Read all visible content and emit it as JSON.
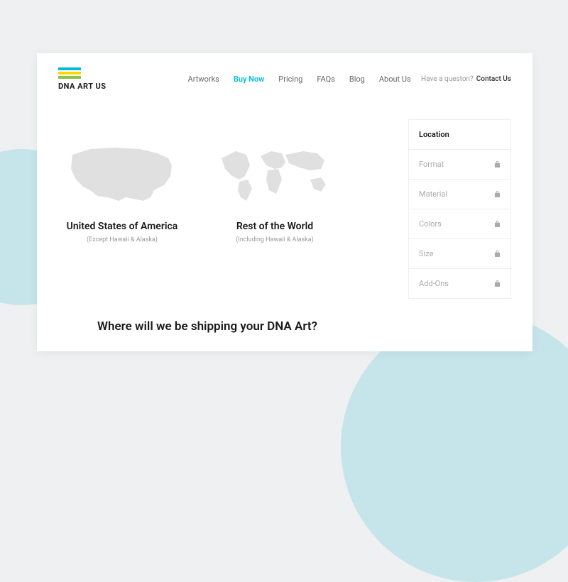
{
  "logo": {
    "text": "DNA ART US"
  },
  "nav": {
    "items": [
      "Artworks",
      "Buy Now",
      "Pricing",
      "FAQs",
      "Blog",
      "About Us"
    ],
    "active_index": 1
  },
  "header_right": {
    "question": "Have a queston?",
    "contact": "Contact Us"
  },
  "options": {
    "usa": {
      "title": "United States of America",
      "subtitle": "(Except Hawaii & Alaska)"
    },
    "world": {
      "title": "Rest of the World",
      "subtitle": "(Including Hawaii & Alaska)"
    }
  },
  "sidebar": [
    {
      "label": "Location",
      "locked": false
    },
    {
      "label": "Format",
      "locked": true
    },
    {
      "label": "Material",
      "locked": true
    },
    {
      "label": "Colors",
      "locked": true
    },
    {
      "label": "Size",
      "locked": true
    },
    {
      "label": "Add-Ons",
      "locked": true
    }
  ],
  "heading": "Where will we be shipping your DNA Art?"
}
